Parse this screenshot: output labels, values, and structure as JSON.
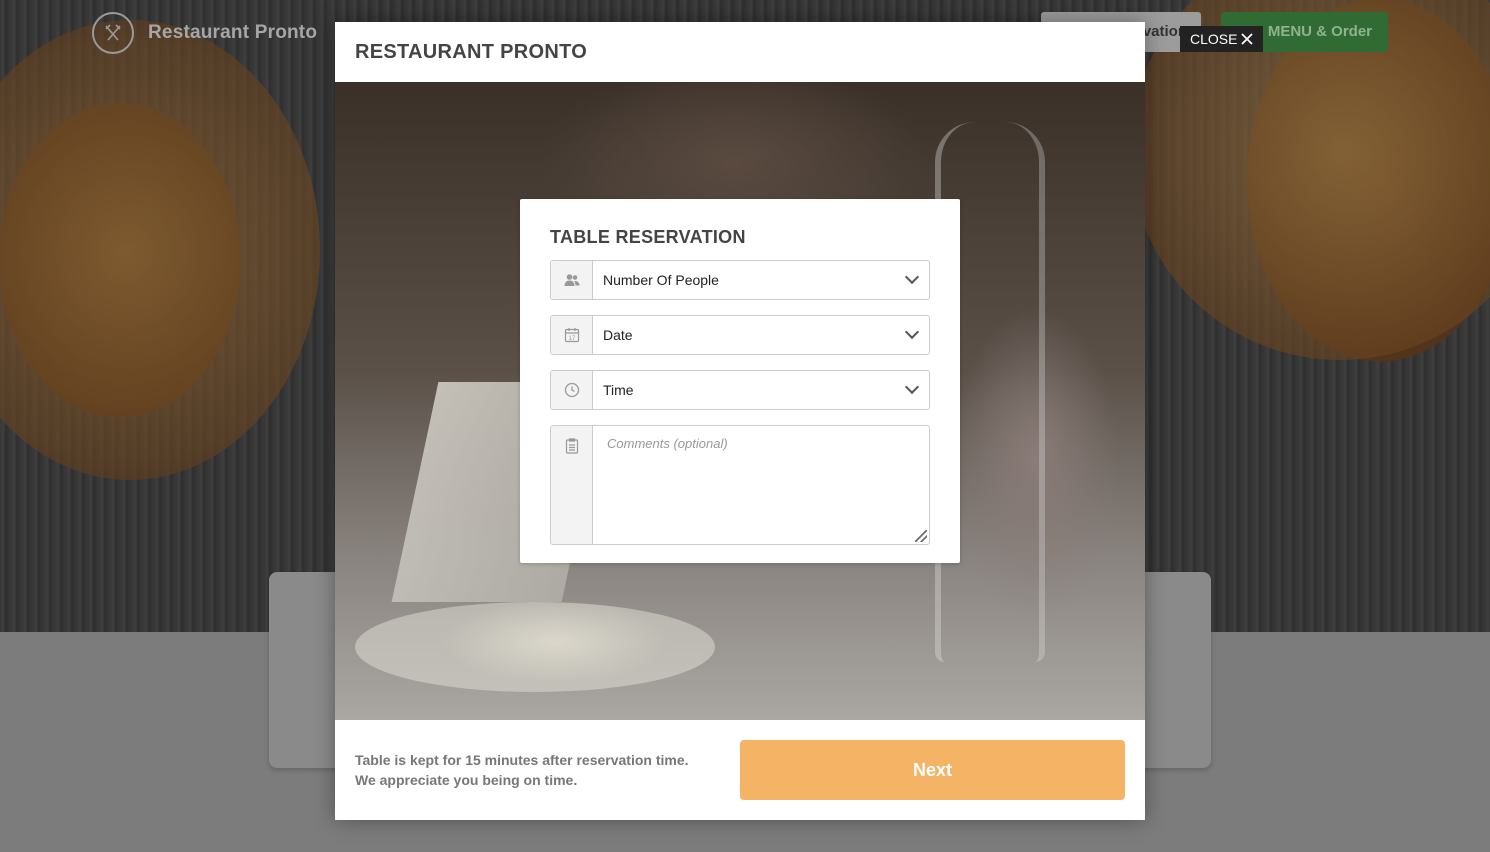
{
  "site": {
    "name": "Restaurant Pronto",
    "reserve_button_label": "Table Reservation",
    "menu_button_label": "See MENU & Order"
  },
  "close_button": {
    "label": "CLOSE",
    "icon": "close-icon"
  },
  "modal": {
    "title": "RESTAURANT PRONTO",
    "form": {
      "title": "TABLE RESERVATION",
      "people": {
        "value": "Number Of People",
        "icon": "people-icon"
      },
      "date": {
        "value": "Date",
        "icon": "calendar-icon"
      },
      "time": {
        "value": "Time",
        "icon": "clock-icon"
      },
      "comments": {
        "placeholder": "Comments (optional)",
        "icon": "notepad-icon"
      }
    },
    "footer": {
      "note_line1": "Table is kept for 15 minutes after reservation time.",
      "note_line2": "We appreciate you being on time.",
      "next_label": "Next"
    }
  },
  "colors": {
    "accent_next": "#f5b366",
    "menu_button": "#2f6b33",
    "modal_bg": "#ffffff",
    "overlay_bg": "#7c7c7c"
  }
}
